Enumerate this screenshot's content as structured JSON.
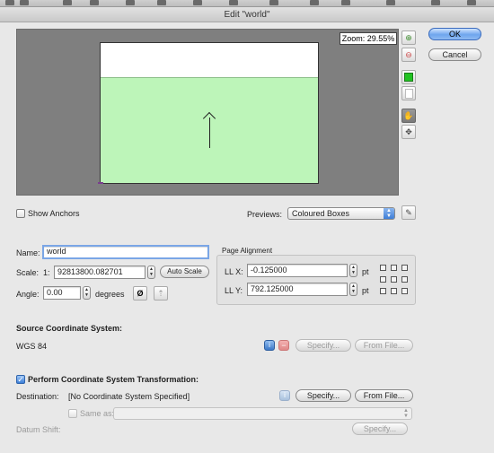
{
  "window": {
    "title": "Edit \"world\""
  },
  "preview": {
    "zoom_text": "Zoom: 29.55%",
    "map_fill_color": "#bdf5b9",
    "canvas_color": "#7f7f7f"
  },
  "side_tools": [
    {
      "name": "zoom-in-icon",
      "glyph": "⊕"
    },
    {
      "name": "zoom-out-icon",
      "glyph": "⊖"
    },
    {
      "name": "fill-color-icon",
      "glyph": "■"
    },
    {
      "name": "blank-page-icon",
      "glyph": "▯"
    },
    {
      "name": "hand-tool-icon",
      "glyph": "✋"
    },
    {
      "name": "move-tool-icon",
      "glyph": "✥"
    }
  ],
  "buttons": {
    "ok": "OK",
    "cancel": "Cancel",
    "auto_scale": "Auto Scale",
    "specify": "Specify...",
    "from_file": "From File..."
  },
  "show_anchors": {
    "label": "Show Anchors",
    "checked": false
  },
  "previews": {
    "label": "Previews:",
    "selected": "Coloured Boxes"
  },
  "name_field": {
    "label": "Name:",
    "value": "world"
  },
  "scale": {
    "label": "Scale:",
    "prefix": "1:",
    "value": "92813800.082701"
  },
  "angle": {
    "label": "Angle:",
    "value": "0.00",
    "unit": "degrees",
    "reset_glyph": "Ø"
  },
  "page_alignment": {
    "title": "Page Alignment",
    "llx_label": "LL X:",
    "llx_value": "-0.125000",
    "lly_label": "LL Y:",
    "lly_value": "792.125000",
    "unit": "pt"
  },
  "source_cs": {
    "title": "Source Coordinate System:",
    "value": "WGS 84"
  },
  "transform": {
    "label": "Perform Coordinate System Transformation:",
    "checked": true,
    "destination_label": "Destination:",
    "destination_value": "[No Coordinate System Specified]",
    "same_as_label": "Same as:",
    "datum_shift_label": "Datum Shift:"
  }
}
